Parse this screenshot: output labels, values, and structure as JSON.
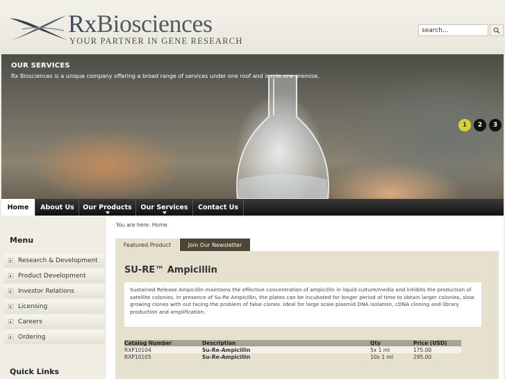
{
  "header": {
    "logo_prefix": "Rx",
    "logo_suffix": "Biosciences",
    "tagline": "YOUR PARTNER IN GENE RESEARCH"
  },
  "search": {
    "placeholder": "search...",
    "value": "search..."
  },
  "banner": {
    "title": "OUR SERVICES",
    "text": "Rx Biosciences is a unique company offering a broad range of services under one roof and inside one premise.",
    "dots": [
      "1",
      "2",
      "3"
    ],
    "active_dot": "1"
  },
  "nav": {
    "items": [
      "Home",
      "About Us",
      "Our Products",
      "Our Services",
      "Contact Us"
    ],
    "active": "Home"
  },
  "sidebar": {
    "title": "Menu",
    "items": [
      "Research & Development",
      "Product Development",
      "Investor Relations",
      "Licensing",
      "Careers",
      "Ordering"
    ],
    "quicklinks_title": "Quick Links"
  },
  "breadcrumb": "You are here: Home",
  "tabs": {
    "featured": "Featured Product",
    "newsletter": "Join Our Newsletter"
  },
  "product": {
    "title": "SU-RE™ Ampicillin",
    "description": "Sustained Release Ampicillin maintains the effective concentration of ampicillin in liquid culture/media and inhibits the production of satellite colonies.  In presence of Su-Re Ampicillin, the plates can be incubated for longer period of time to obtain larger colonies, slow growing clones with out facing the problem of false clones.  Ideal for large scale plasmid DNA isolation, cDNA cloning and library production and amplification.",
    "table": {
      "headers": [
        "Catalog Number",
        "Description",
        "Qty",
        "Price (USD)"
      ],
      "rows": [
        [
          "RXP10104",
          "Su-Re-Ampicillin",
          "5x 1 ml",
          "175.00"
        ],
        [
          "RXP10105",
          "Su-Re-Ampicillin",
          "10x 1 ml",
          "295.00"
        ]
      ]
    }
  },
  "colors": {
    "nav_bg": "#1a1a1a",
    "active_dot": "#d7cf3c",
    "panel_bg": "#e5e1ce",
    "tab_dark": "#4d4535"
  }
}
